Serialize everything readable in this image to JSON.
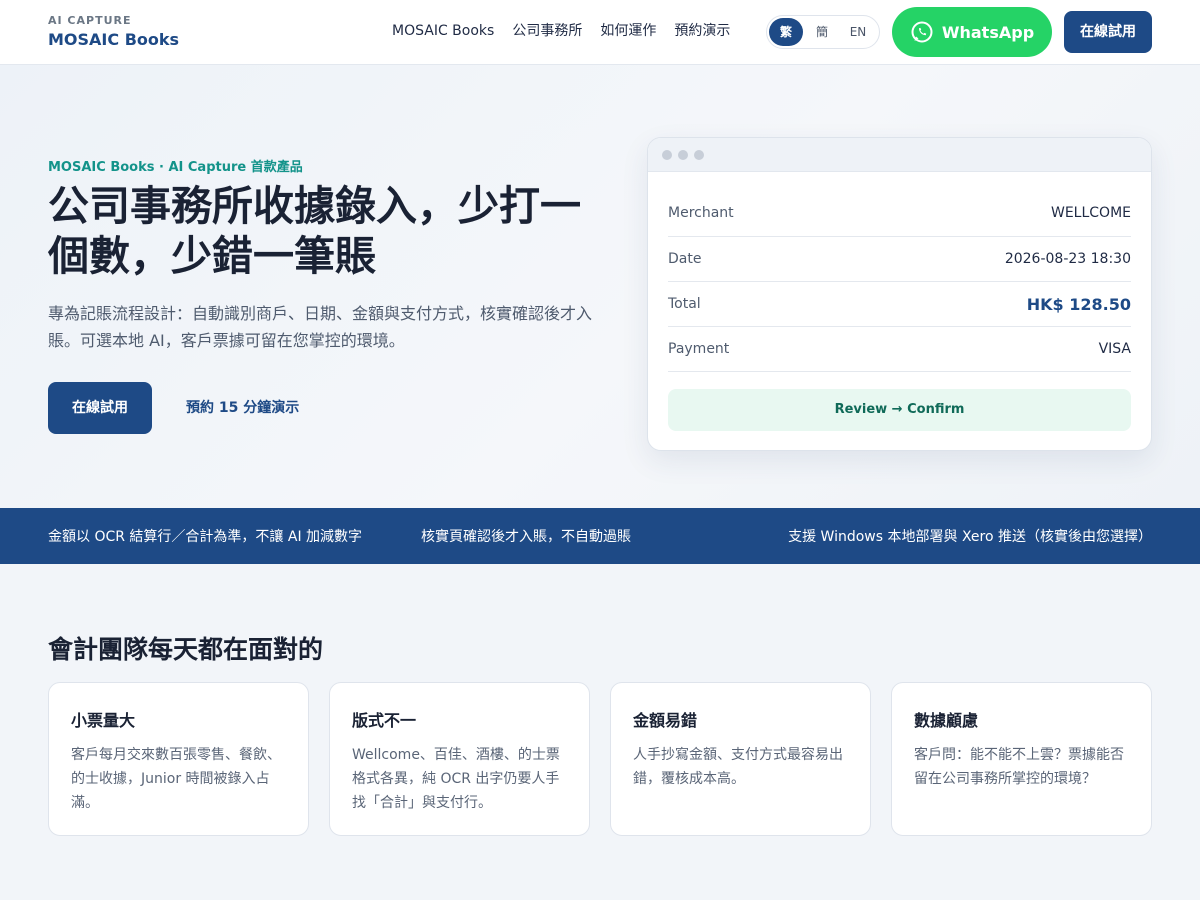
{
  "header": {
    "brand_kicker": "AI CAPTURE",
    "brand_name": "MOSAIC Books",
    "nav": [
      "MOSAIC Books",
      "公司事務所",
      "如何運作",
      "預約演示"
    ],
    "lang": [
      "繁",
      "簡",
      "EN"
    ],
    "lang_selected": "繁",
    "whatsapp_label": "WhatsApp",
    "cta_label": "在線試用"
  },
  "hero": {
    "eyebrow": "MOSAIC Books · AI Capture 首款產品",
    "title": "公司事務所收據錄入，少打一個數，少錯一筆賬",
    "subtitle": "專為記賬流程設計：自動識別商戶、日期、金額與支付方式，核實確認後才入賬。可選本地 AI，客戶票據可留在您掌控的環境。",
    "cta_primary": "在線試用",
    "cta_secondary": "預約 15 分鐘演示"
  },
  "receipt": {
    "rows": [
      {
        "label": "Merchant",
        "value": "WELLCOME"
      },
      {
        "label": "Date",
        "value": "2026-08-23 18:30"
      },
      {
        "label": "Total",
        "value": "HK$ 128.50"
      },
      {
        "label": "Payment",
        "value": "VISA"
      }
    ],
    "action": "Review → Confirm"
  },
  "stripe": [
    "金額以 OCR 結算行／合計為準，不讓 AI 加減數字",
    "核實頁確認後才入賬，不自動過賬",
    "支援 Windows 本地部署與 Xero 推送（核實後由您選擇）"
  ],
  "pain_section": {
    "title": "會計團隊每天都在面對的",
    "cards": [
      {
        "title": "小票量大",
        "body": "客戶每月交來數百張零售、餐飲、的士收據，Junior 時間被錄入占滿。"
      },
      {
        "title": "版式不一",
        "body": "Wellcome、百佳、酒樓、的士票格式各異，純 OCR 出字仍要人手找「合計」與支付行。"
      },
      {
        "title": "金額易錯",
        "body": "人手抄寫金額、支付方式最容易出錯，覆核成本高。"
      },
      {
        "title": "數據顧慮",
        "body": "客戶問：能不能不上雲？票據能否留在公司事務所掌控的環境？"
      }
    ]
  },
  "colors": {
    "brand": "#1e4a86",
    "accent_teal": "#13938a",
    "whatsapp": "#25d366"
  }
}
